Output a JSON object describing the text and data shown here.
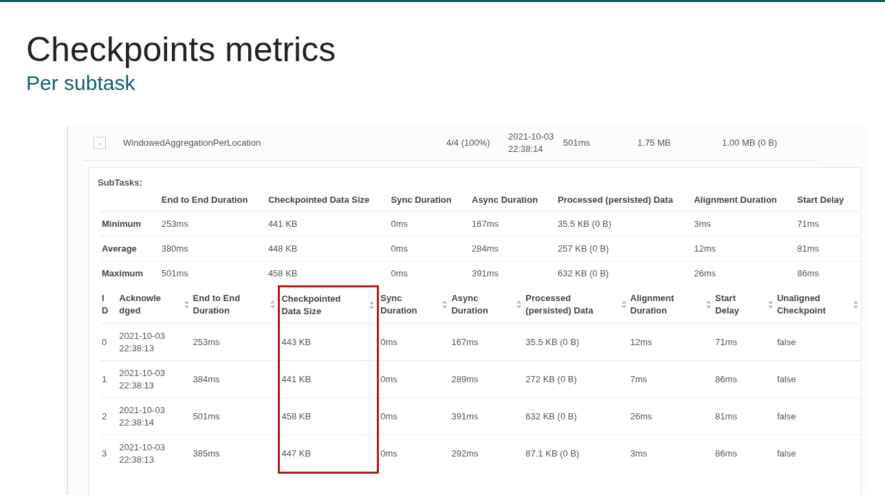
{
  "slide": {
    "title": "Checkpoints metrics",
    "subtitle": "Per subtask"
  },
  "vertex_row": {
    "toggle": "-",
    "cells": [
      "WindowedAggregationPerLocation",
      "4/4 (100%)",
      "2021-10-03 22:38:14",
      "501ms",
      "1.75 MB",
      "1.00 MB (0 B)"
    ]
  },
  "subtasks": {
    "label": "SubTasks:",
    "summary": {
      "columns": [
        "End to End Duration",
        "Checkpointed Data Size",
        "Sync Duration",
        "Async Duration",
        "Processed (persisted) Data",
        "Alignment Duration",
        "Start Delay"
      ],
      "rows": [
        {
          "label": "Minimum",
          "cells": [
            "253ms",
            "441 KB",
            "0ms",
            "167ms",
            "35.5 KB (0 B)",
            "3ms",
            "71ms"
          ]
        },
        {
          "label": "Average",
          "cells": [
            "380ms",
            "448 KB",
            "0ms",
            "284ms",
            "257 KB (0 B)",
            "12ms",
            "81ms"
          ]
        },
        {
          "label": "Maximum",
          "cells": [
            "501ms",
            "458 KB",
            "0ms",
            "391ms",
            "632 KB (0 B)",
            "26ms",
            "86ms"
          ]
        }
      ]
    },
    "table": {
      "columns": [
        {
          "label": "ID",
          "sortable": false,
          "highlighted": false
        },
        {
          "label": "Acknowledged",
          "sortable": true,
          "highlighted": false
        },
        {
          "label": "End to End Duration",
          "sortable": true,
          "highlighted": false
        },
        {
          "label": "Checkpointed Data Size",
          "sortable": true,
          "highlighted": true
        },
        {
          "label": "Sync Duration",
          "sortable": true,
          "highlighted": false
        },
        {
          "label": "Async Duration",
          "sortable": true,
          "highlighted": false
        },
        {
          "label": "Processed (persisted) Data",
          "sortable": true,
          "highlighted": false
        },
        {
          "label": "Alignment Duration",
          "sortable": true,
          "highlighted": false
        },
        {
          "label": "Start Delay",
          "sortable": true,
          "highlighted": false
        },
        {
          "label": "Unaligned Checkpoint",
          "sortable": true,
          "highlighted": false
        }
      ],
      "rows": [
        {
          "cells": [
            "0",
            "2021-10-03 22:38:13",
            "253ms",
            "443 KB",
            "0ms",
            "167ms",
            "35.5 KB (0 B)",
            "12ms",
            "71ms",
            "false"
          ]
        },
        {
          "cells": [
            "1",
            "2021-10-03 22:38:13",
            "384ms",
            "441 KB",
            "0ms",
            "289ms",
            "272 KB (0 B)",
            "7ms",
            "86ms",
            "false"
          ]
        },
        {
          "cells": [
            "2",
            "2021-10-03 22:38:14",
            "501ms",
            "458 KB",
            "0ms",
            "391ms",
            "632 KB (0 B)",
            "26ms",
            "81ms",
            "false"
          ]
        },
        {
          "cells": [
            "3",
            "2021-10-03 22:38:13",
            "385ms",
            "447 KB",
            "0ms",
            "292ms",
            "87.1 KB (0 B)",
            "3ms",
            "86ms",
            "false"
          ]
        }
      ]
    }
  }
}
